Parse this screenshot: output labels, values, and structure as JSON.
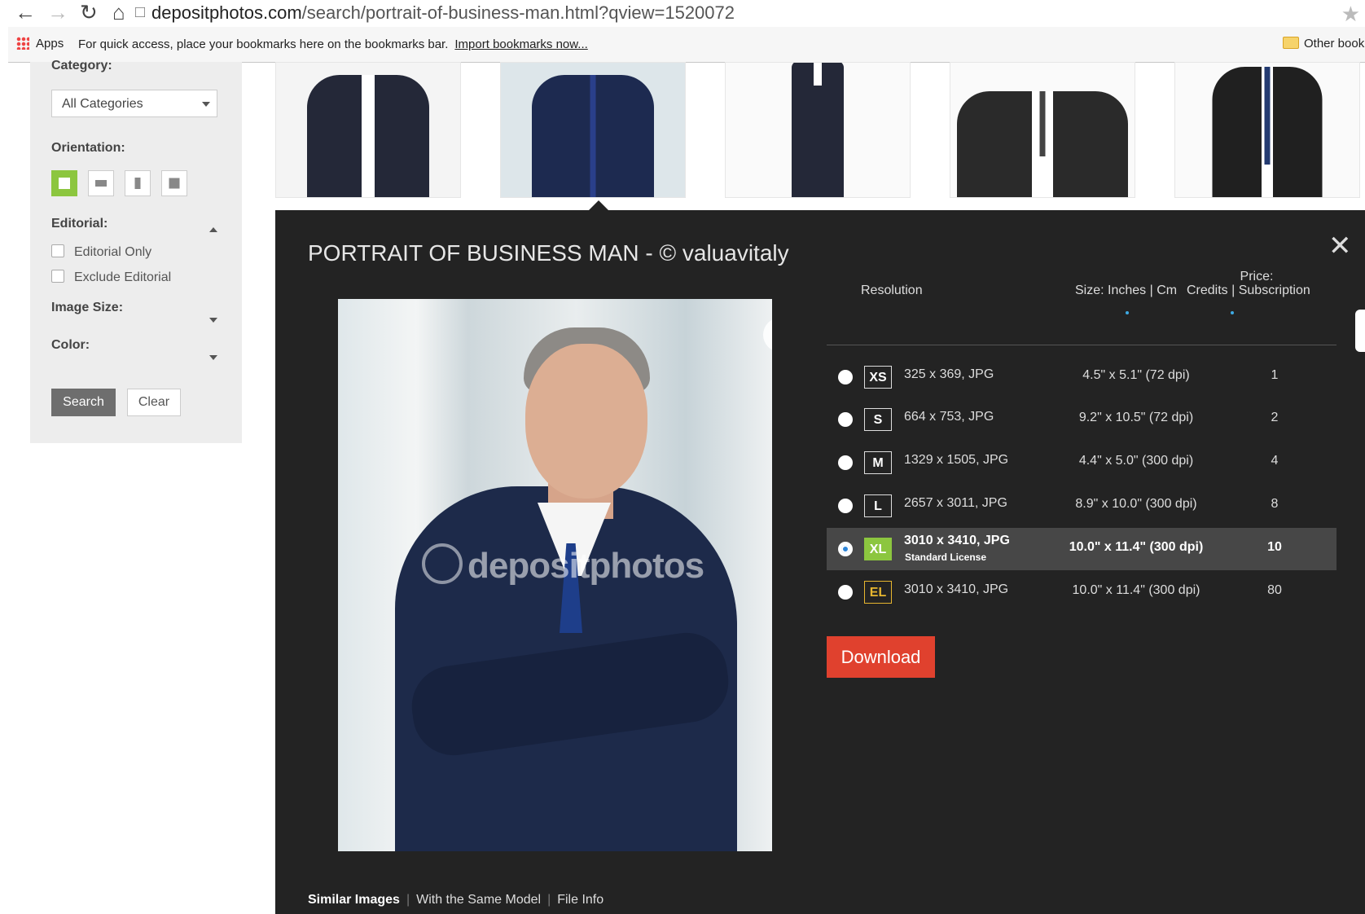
{
  "browser": {
    "url_host": "depositphotos.com",
    "url_path": "/search/portrait-of-business-man.html?qview=1520072",
    "bookmarks_apps": "Apps",
    "bookmarks_hint": "For quick access, place your bookmarks here on the bookmarks bar.",
    "bookmarks_import": "Import bookmarks now...",
    "bookmarks_other": "Other book"
  },
  "filters": {
    "category_label": "Category:",
    "category_value": "All Categories",
    "orientation_label": "Orientation:",
    "editorial_label": "Editorial:",
    "editorial_only": "Editorial Only",
    "exclude_editorial": "Exclude Editorial",
    "image_size_label": "Image Size:",
    "color_label": "Color:",
    "search_button": "Search",
    "clear_button": "Clear"
  },
  "viewer": {
    "title": "PORTRAIT OF BUSINESS MAN - © valuavitaly",
    "watermark": "depositphotos",
    "table_headers": {
      "resolution": "Resolution",
      "size": "Size: Inches | Cm",
      "price_line1": "Price:",
      "price_line2": "Credits | Subscription"
    },
    "rows": [
      {
        "badge": "XS",
        "resolution": "325 x 369, JPG",
        "size": "4.5\" x 5.1\" (72 dpi)",
        "price": "1"
      },
      {
        "badge": "S",
        "resolution": "664 x 753, JPG",
        "size": "9.2\" x 10.5\" (72 dpi)",
        "price": "2"
      },
      {
        "badge": "M",
        "resolution": "1329 x 1505, JPG",
        "size": "4.4\" x 5.0\" (300 dpi)",
        "price": "4"
      },
      {
        "badge": "L",
        "resolution": "2657 x 3011, JPG",
        "size": "8.9\" x 10.0\" (300 dpi)",
        "price": "8"
      },
      {
        "badge": "XL",
        "resolution": "3010 x 3410, JPG",
        "license": "Standard License",
        "size": "10.0\" x 11.4\" (300 dpi)",
        "price": "10"
      },
      {
        "badge": "EL",
        "resolution": "3010 x 3410, JPG",
        "size": "10.0\" x 11.4\" (300 dpi)",
        "price": "80"
      }
    ],
    "selected_row": "XL",
    "download_button": "Download",
    "bottom_links": [
      "Similar Images",
      "With the Same Model",
      "File Info"
    ]
  },
  "colors": {
    "accent_green": "#8cc63f",
    "download_red": "#e0412e",
    "viewer_bg": "#232323",
    "el_gold": "#e7b62f"
  }
}
